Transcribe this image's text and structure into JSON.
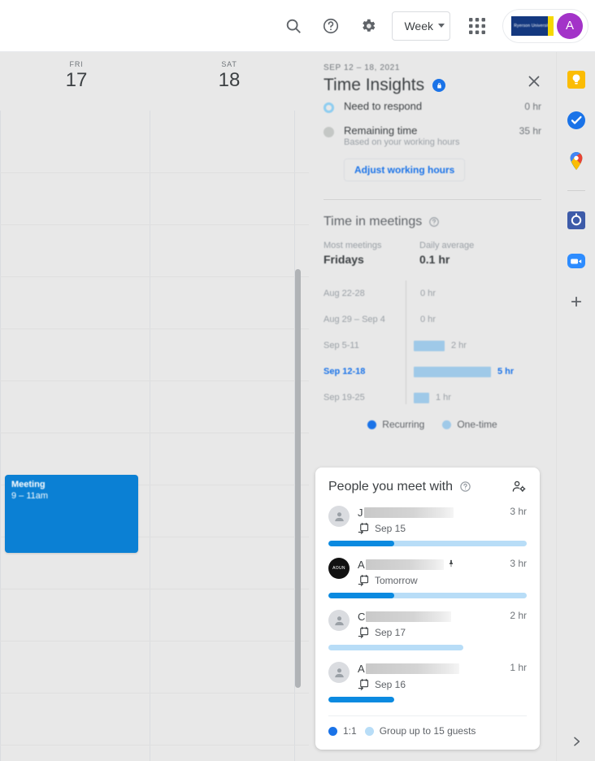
{
  "topbar": {
    "search_icon": "search-icon",
    "help_icon": "help-icon",
    "settings_icon": "gear-icon",
    "view_label": "Week",
    "apps_icon": "apps-grid-icon",
    "org_logo_text": "Ryerson University",
    "avatar_initial": "A"
  },
  "calendar": {
    "columns": [
      {
        "dow": "FRI",
        "day": "17"
      },
      {
        "dow": "SAT",
        "day": "18"
      }
    ],
    "events": [
      {
        "title": "Meeting",
        "time": "9 – 11am",
        "color": "#0b80d4"
      }
    ]
  },
  "panel": {
    "date_range": "SEP 12 – 18, 2021",
    "title": "Time Insights",
    "lock_icon": "lock-icon",
    "close_icon": "close-icon",
    "summary_rows": [
      {
        "label": "Need to respond",
        "value": "0 hr",
        "marker": "ring"
      },
      {
        "label": "Remaining time",
        "value": "35 hr",
        "sub": "Based on your working hours",
        "marker": "dot"
      }
    ],
    "adjust_button": "Adjust working hours",
    "meetings": {
      "title": "Time in meetings",
      "help_icon": "help-circle-icon",
      "stats": [
        {
          "key": "Most meetings",
          "value": "Fridays"
        },
        {
          "key": "Daily average",
          "value": "0.1 hr"
        }
      ],
      "legend": [
        {
          "label": "Recurring",
          "color": "#1a73e8"
        },
        {
          "label": "One-time",
          "color": "#9fc9e8"
        }
      ]
    }
  },
  "chart_data": {
    "type": "bar",
    "title": "Time in meetings",
    "orientation": "horizontal",
    "categories": [
      "Aug 22-28",
      "Aug 29 – Sep 4",
      "Sep 5-11",
      "Sep 12-18",
      "Sep 19-25"
    ],
    "values": [
      0,
      0,
      2,
      5,
      1
    ],
    "value_labels": [
      "0 hr",
      "0 hr",
      "2 hr",
      "5 hr",
      "1 hr"
    ],
    "highlighted_category": "Sep 12-18",
    "xlabel": "",
    "ylabel": "",
    "xlim": [
      0,
      5
    ],
    "grid": false,
    "bar_color": "#9fc9e8",
    "legend": [
      "Recurring",
      "One-time"
    ],
    "legend_position": "bottom"
  },
  "people": {
    "title": "People you meet with",
    "help_icon": "help-circle-icon",
    "manage_icon": "manage-people-icon",
    "list": [
      {
        "name_prefix": "J",
        "redact_width": 110,
        "hours": "3 hr",
        "when": "Sep 15",
        "fill_pct": 33,
        "avatar": "generic",
        "pinned": false
      },
      {
        "name_prefix": "A",
        "redact_width": 96,
        "hours": "3 hr",
        "when": "Tomorrow",
        "fill_pct": 33,
        "avatar": "dark",
        "avatar_text": "AOUN",
        "pinned": true
      },
      {
        "name_prefix": "C",
        "redact_width": 105,
        "hours": "2 hr",
        "when": "Sep 17",
        "fill_pct": 0,
        "bar_width_pct": 68,
        "avatar": "generic",
        "pinned": false
      },
      {
        "name_prefix": "A",
        "redact_width": 115,
        "hours": "1 hr",
        "when": "Sep 16",
        "fill_pct": 100,
        "bar_width_pct": 33,
        "avatar": "generic",
        "pinned": false
      }
    ],
    "legend": [
      {
        "label": "1:1",
        "color": "#1a73e8"
      },
      {
        "label": "Group up to 15 guests",
        "color": "#b8ddf7"
      }
    ]
  },
  "rail": {
    "items": [
      {
        "name": "keep-icon"
      },
      {
        "name": "tasks-icon"
      },
      {
        "name": "maps-icon"
      },
      {
        "name": "app-icon"
      },
      {
        "name": "zoom-icon"
      },
      {
        "name": "add-addon-icon"
      }
    ],
    "expand_icon": "chevron-right-icon"
  }
}
